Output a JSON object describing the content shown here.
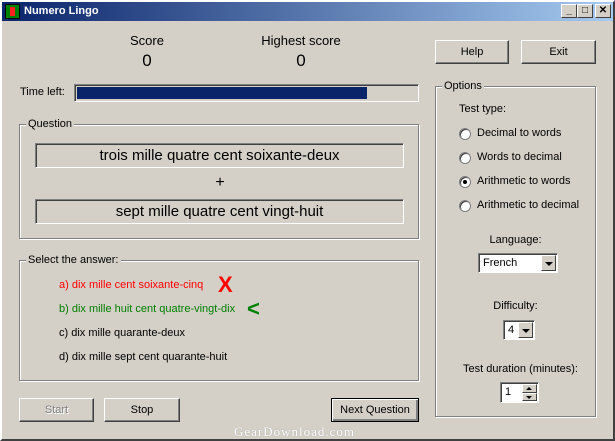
{
  "window": {
    "title": "Numero Lingo",
    "min": "_",
    "max": "□",
    "close": "✕"
  },
  "score": {
    "label": "Score",
    "value": "0"
  },
  "highest": {
    "label": "Highest score",
    "value": "0"
  },
  "buttons": {
    "help": "Help",
    "exit": "Exit",
    "start": "Start",
    "stop": "Stop",
    "next": "Next Question"
  },
  "timer": {
    "label": "Time left:",
    "remaining_fraction": 0.855
  },
  "question": {
    "group_label": "Question",
    "operand1": "trois mille quatre cent soixante-deux",
    "operator": "+",
    "operand2": "sept mille quatre cent vingt-huit"
  },
  "answers": {
    "group_label": "Select the answer:",
    "items": [
      {
        "text": "a) dix mille cent soixante-cinq",
        "color": "#ff0000",
        "mark": "X",
        "mark_color": "#ff0000"
      },
      {
        "text": "b) dix mille huit cent quatre-vingt-dix",
        "color": "#008000",
        "mark": "<",
        "mark_color": "#008000"
      },
      {
        "text": "c) dix mille quarante-deux",
        "color": "#000000",
        "mark": "",
        "mark_color": "#000000"
      },
      {
        "text": "d) dix mille sept cent quarante-huit",
        "color": "#000000",
        "mark": "",
        "mark_color": "#000000"
      }
    ]
  },
  "options": {
    "group_label": "Options",
    "test_type_label": "Test type:",
    "test_types": [
      {
        "label": "Decimal to words",
        "selected": false
      },
      {
        "label": "Words to decimal",
        "selected": false
      },
      {
        "label": "Arithmetic to words",
        "selected": true
      },
      {
        "label": "Arithmetic to decimal",
        "selected": false
      }
    ],
    "language_label": "Language:",
    "language_value": "French",
    "difficulty_label": "Difficulty:",
    "difficulty_value": "4",
    "duration_label": "Test duration (minutes):",
    "duration_value": "1"
  },
  "watermark": "GearDownload.com"
}
